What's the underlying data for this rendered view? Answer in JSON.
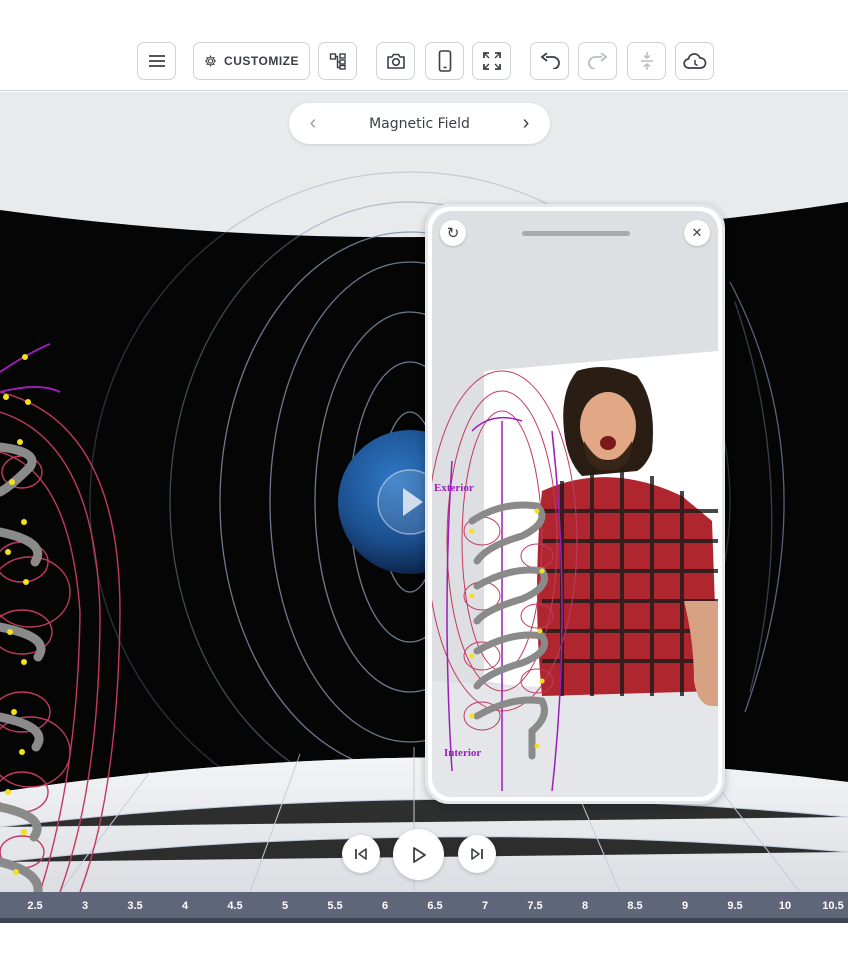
{
  "toolbar": {
    "customize_label": "CUSTOMIZE",
    "buttons": [
      "menu-icon",
      "gear-icon",
      "hierarchy-icon",
      "camera-icon",
      "phone-icon",
      "fullscreen-icon",
      "undo-icon",
      "redo-icon",
      "compress-icon",
      "cloud-icon"
    ]
  },
  "navigator": {
    "title": "Magnetic Field",
    "prev": "‹",
    "next": "›"
  },
  "scene": {
    "label_exterior": "Exterior",
    "label_interior": "Interior"
  },
  "phone_preview": {
    "refresh": "↻",
    "close": "✕"
  },
  "playback": {
    "prev": "prev-frame-icon",
    "play": "play-icon",
    "next": "next-frame-icon"
  },
  "timeline": {
    "ticks": [
      "2.5",
      "3",
      "3.5",
      "4",
      "4.5",
      "5",
      "5.5",
      "6",
      "6.5",
      "7",
      "7.5",
      "8",
      "8.5",
      "9",
      "9.5",
      "10",
      "10.5"
    ]
  },
  "colors": {
    "accent_timeline": "#5f6679",
    "field_line": "#c23a5e",
    "field_line_purple": "#9b1fb8",
    "arrow": "#f2e21a",
    "coil": "#8a8a8a"
  }
}
